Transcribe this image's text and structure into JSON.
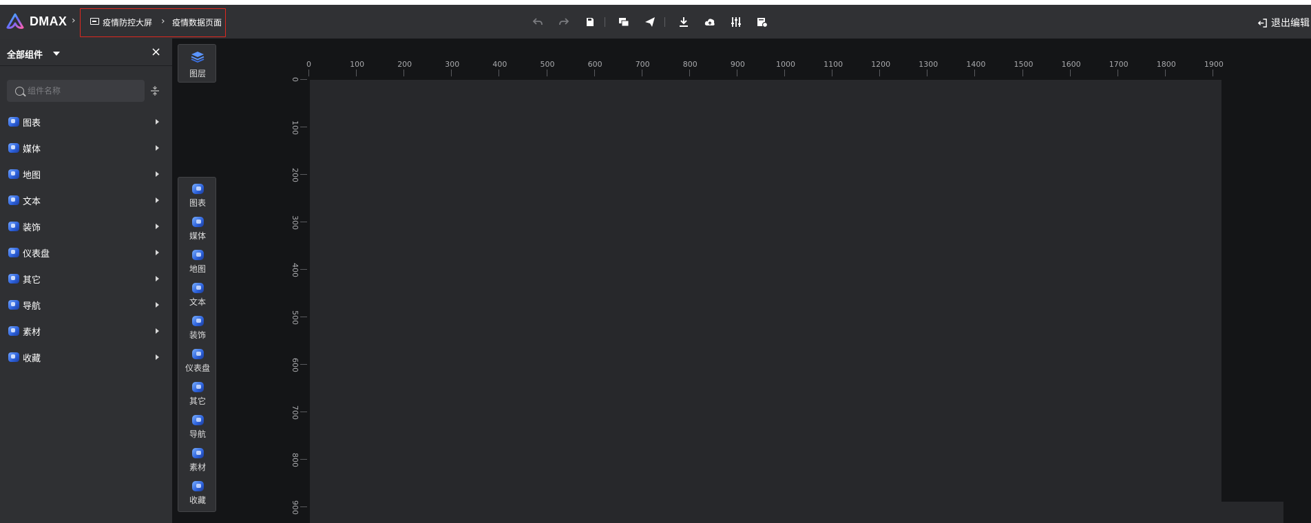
{
  "header": {
    "brand": "DMAX",
    "breadcrumb": [
      "疫情防控大屏",
      "疫情数据页面"
    ],
    "exit_label": "退出编辑",
    "toolbar_icons": [
      "undo-icon",
      "redo-icon",
      "save-icon",
      "preview-icon",
      "publish-icon",
      "download-icon",
      "upload-cloud-icon",
      "settings-sliders-icon",
      "config-icon"
    ]
  },
  "sidebar": {
    "title": "全部组件",
    "search_placeholder": "组件名称",
    "categories": [
      {
        "label": "图表"
      },
      {
        "label": "媒体"
      },
      {
        "label": "地图"
      },
      {
        "label": "文本"
      },
      {
        "label": "装饰"
      },
      {
        "label": "仪表盘"
      },
      {
        "label": "其它"
      },
      {
        "label": "导航"
      },
      {
        "label": "素材"
      },
      {
        "label": "收藏"
      }
    ]
  },
  "rail": {
    "layer_label": "图层",
    "items": [
      {
        "label": "图表"
      },
      {
        "label": "媒体"
      },
      {
        "label": "地图"
      },
      {
        "label": "文本"
      },
      {
        "label": "装饰"
      },
      {
        "label": "仪表盘"
      },
      {
        "label": "其它"
      },
      {
        "label": "导航"
      },
      {
        "label": "素材"
      },
      {
        "label": "收藏"
      }
    ]
  },
  "rulers": {
    "horizontal": [
      "0",
      "100",
      "200",
      "300",
      "400",
      "500",
      "600",
      "700",
      "800",
      "900",
      "1000",
      "1100",
      "1200",
      "1300",
      "1400",
      "1500",
      "1600",
      "1700",
      "1800",
      "1900"
    ],
    "vertical": [
      "0",
      "100",
      "200",
      "300",
      "400",
      "500",
      "600",
      "700",
      "800",
      "900"
    ]
  },
  "colors": {
    "accent_border": "#e0281f",
    "header_bg": "#303134",
    "canvas_bg": "#27282b"
  }
}
